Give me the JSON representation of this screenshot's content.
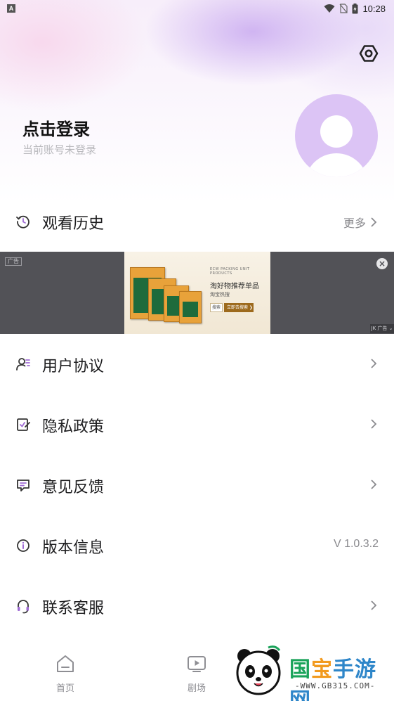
{
  "status_bar": {
    "left_icon_label": "A",
    "time": "10:28",
    "icons": [
      "wifi-icon",
      "sim-off-icon",
      "battery-charging-icon"
    ]
  },
  "header": {
    "settings_icon": "hexagon-settings-icon",
    "login_title": "点击登录",
    "login_subtitle": "当前账号未登录",
    "avatar_color": "#dcc4f5"
  },
  "history": {
    "label": "观看历史",
    "more": "更多",
    "icon": "history-clock-icon"
  },
  "ad": {
    "tag": "广告",
    "small_text": "ECW PACKING UNIT PRODUCTS",
    "headline": "淘好物推荐单品",
    "subline": "淘宝热搜",
    "search_label": "搜索",
    "cta_label": "立即去搜索 ❯",
    "source_label": "JK 广告 ⌄",
    "close_symbol": "×"
  },
  "menu": [
    {
      "label": "用户协议",
      "icon": "user-agreement-icon",
      "right": ""
    },
    {
      "label": "隐私政策",
      "icon": "privacy-policy-icon",
      "right": ""
    },
    {
      "label": "意见反馈",
      "icon": "feedback-message-icon",
      "right": ""
    },
    {
      "label": "版本信息",
      "icon": "info-circle-icon",
      "right": "V 1.0.3.2"
    },
    {
      "label": "联系客服",
      "icon": "headset-icon",
      "right": ""
    }
  ],
  "tabbar": {
    "tabs": [
      {
        "label": "首页",
        "icon": "home-icon"
      },
      {
        "label": "剧场",
        "icon": "play-tv-icon"
      }
    ]
  },
  "watermark": {
    "title_part1": "国",
    "title_part2": "宝",
    "title_part3": "手游网",
    "url": "-WWW.GB315.COM-"
  },
  "colors": {
    "accent_purple": "#a06cd5",
    "text_primary": "#1d1d1f",
    "text_secondary": "#8a8a8e",
    "ad_background": "#525257"
  }
}
